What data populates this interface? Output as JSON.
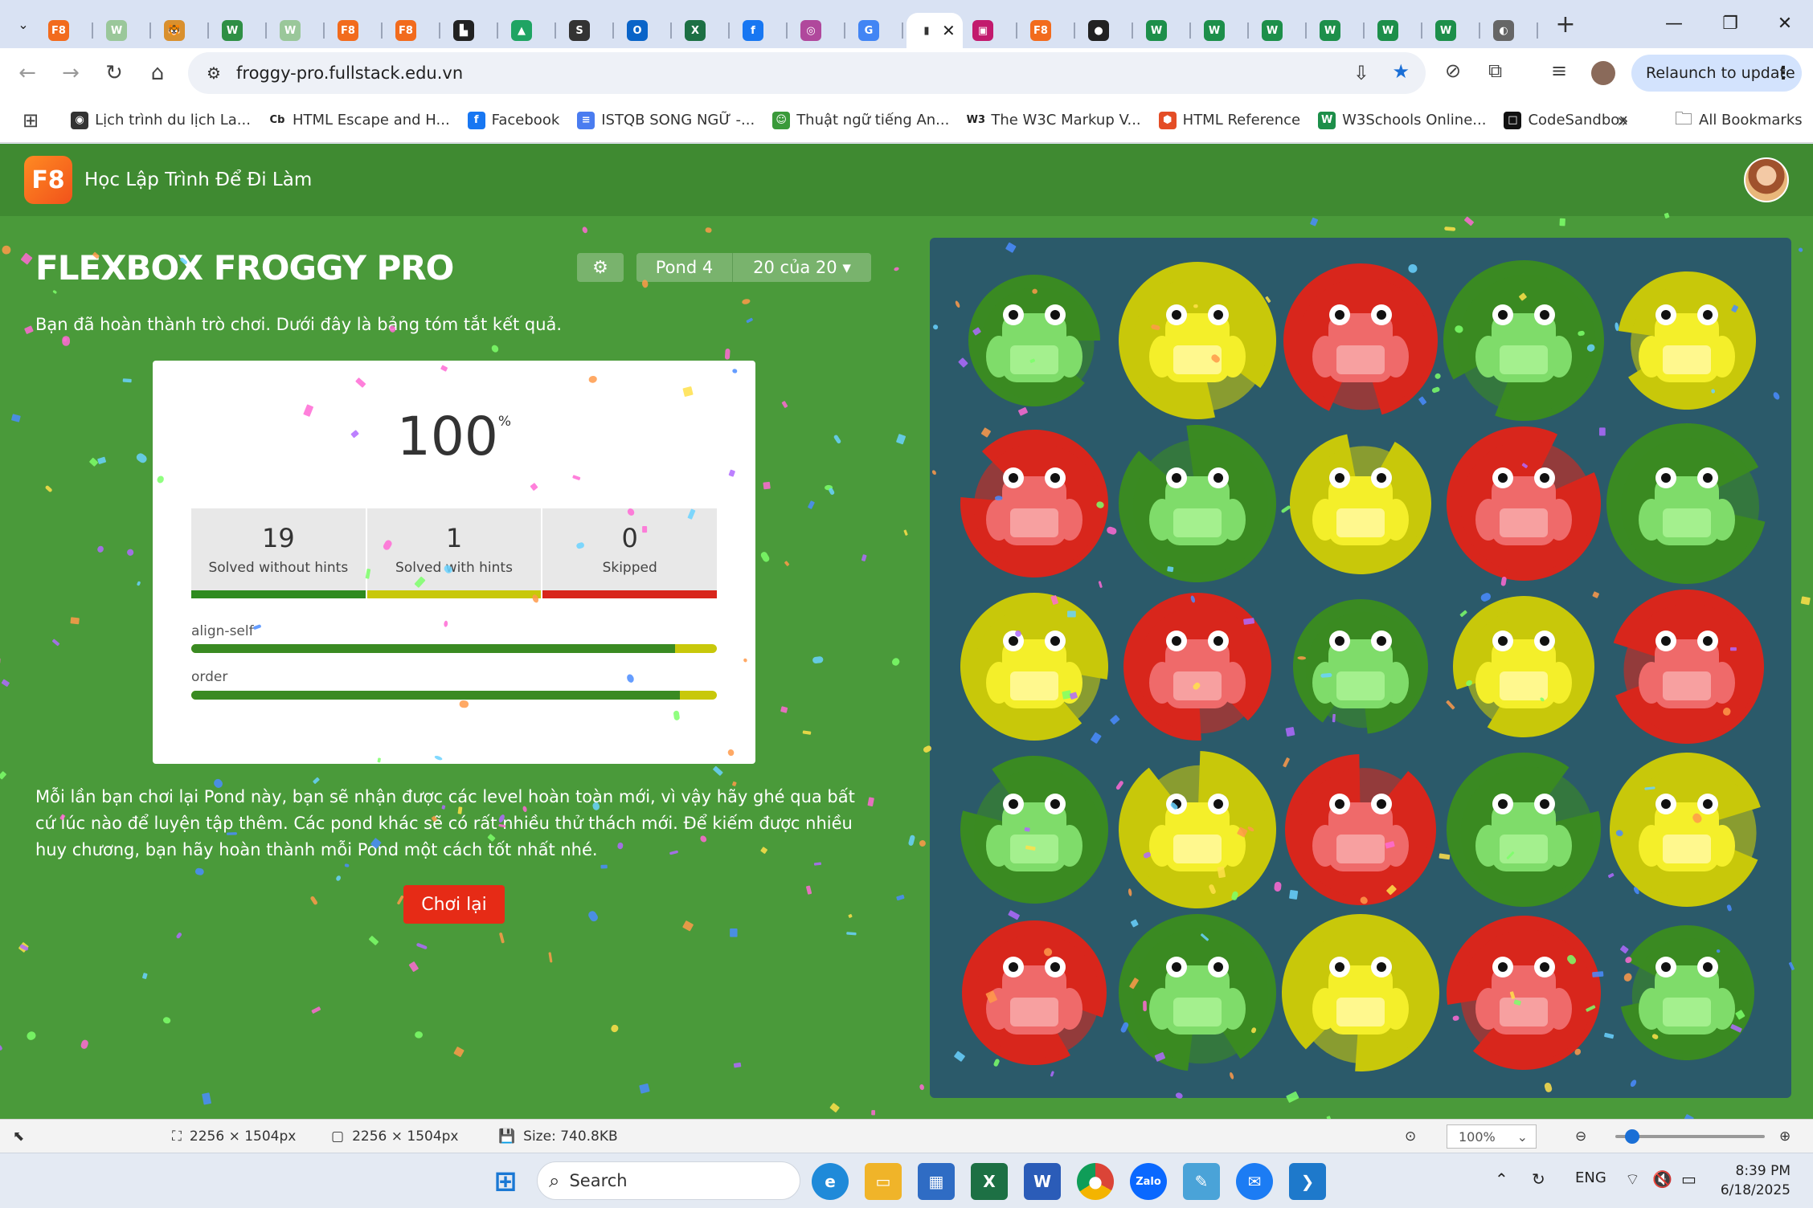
{
  "browser": {
    "tabs": [
      {
        "icon": "f8-icon",
        "bg": "#f26b1d",
        "glyph": "F8"
      },
      {
        "icon": "w3schools-icon",
        "bg": "#9ac79a",
        "glyph": "W"
      },
      {
        "icon": "tiger-icon",
        "bg": "#d9902e",
        "glyph": "🐯"
      },
      {
        "icon": "w3-green-icon",
        "bg": "#2f8f45",
        "glyph": "W"
      },
      {
        "icon": "w3schools-icon",
        "bg": "#9ac79a",
        "glyph": "W"
      },
      {
        "icon": "f8-icon",
        "bg": "#f26b1d",
        "glyph": "F8"
      },
      {
        "icon": "f8-icon",
        "bg": "#f26b1d",
        "glyph": "F8"
      },
      {
        "icon": "notion-icon",
        "bg": "#222",
        "glyph": "▙"
      },
      {
        "icon": "google-drive-icon",
        "bg": "#1fa463",
        "glyph": "▲"
      },
      {
        "icon": "studocu-icon",
        "bg": "#333",
        "glyph": "S"
      },
      {
        "icon": "outlook-icon",
        "bg": "#0a64c8",
        "glyph": "O"
      },
      {
        "icon": "excel-icon",
        "bg": "#1d7044",
        "glyph": "X"
      },
      {
        "icon": "facebook-icon",
        "bg": "#1877f2",
        "glyph": "f"
      },
      {
        "icon": "pink-app-icon",
        "bg": "#b0489c",
        "glyph": "◎"
      },
      {
        "icon": "google-icon",
        "bg": "#4285f4",
        "glyph": "G"
      },
      {
        "icon": "froggy-icon",
        "bg": "#ffffff",
        "glyph": "▮",
        "active": true
      },
      {
        "icon": "pink-square-icon",
        "bg": "#c21a6d",
        "glyph": "▣"
      },
      {
        "icon": "f8-icon",
        "bg": "#f26b1d",
        "glyph": "F8"
      },
      {
        "icon": "github-icon",
        "bg": "#222",
        "glyph": "●"
      },
      {
        "icon": "w3schools-icon",
        "bg": "#1d8f4a",
        "glyph": "W"
      },
      {
        "icon": "w3schools-icon",
        "bg": "#1d8f4a",
        "glyph": "W"
      },
      {
        "icon": "w3schools-icon",
        "bg": "#1d8f4a",
        "glyph": "W"
      },
      {
        "icon": "w3schools-icon",
        "bg": "#1d8f4a",
        "glyph": "W"
      },
      {
        "icon": "w3schools-icon",
        "bg": "#1d8f4a",
        "glyph": "W"
      },
      {
        "icon": "w3schools-icon",
        "bg": "#1d8f4a",
        "glyph": "W"
      },
      {
        "icon": "globe-icon",
        "bg": "#666",
        "glyph": "◐"
      }
    ],
    "url": "froggy-pro.fullstack.edu.vn",
    "relaunch": "Relaunch to update",
    "bookmarks": [
      {
        "label": "Lịch trình du lịch La...",
        "icon": "travel-icon",
        "bg": "#333",
        "glyph": "◉"
      },
      {
        "label": "HTML Escape and H...",
        "icon": "cb-icon",
        "bg": "#fff",
        "glyph": "Cb"
      },
      {
        "label": "Facebook",
        "icon": "facebook-icon",
        "bg": "#1877f2",
        "glyph": "f"
      },
      {
        "label": "ISTQB SONG NGỮ -...",
        "icon": "docs-icon",
        "bg": "#4a7cf0",
        "glyph": "≡"
      },
      {
        "label": "Thuật ngữ tiếng An...",
        "icon": "frog-icon",
        "bg": "#3a9a3a",
        "glyph": "☺"
      },
      {
        "label": "The W3C Markup V...",
        "icon": "w3c-icon",
        "bg": "#fff",
        "glyph": "W3"
      },
      {
        "label": "HTML Reference",
        "icon": "html-ref-icon",
        "bg": "#e44d26",
        "glyph": "⬢"
      },
      {
        "label": "W3Schools Online...",
        "icon": "w3schools-icon",
        "bg": "#1d8f4a",
        "glyph": "W"
      },
      {
        "label": "CodeSandbox",
        "icon": "codesandbox-icon",
        "bg": "#111",
        "glyph": "□"
      }
    ],
    "all_bookmarks": "All Bookmarks"
  },
  "site": {
    "logo": "F8",
    "title": "Học Lập Trình Để Đi Làm"
  },
  "game": {
    "title": "FLEXBOX FROGGY PRO",
    "pond": "Pond 4",
    "level": "20 của 20 ▾",
    "intro": "Bạn đã hoàn thành trò chơi. Dưới đây là bảng tóm tắt kết quả.",
    "score": "100",
    "score_unit": "%",
    "stats": [
      {
        "value": "19",
        "label": "Solved without hints",
        "color": "#2e8b1f"
      },
      {
        "value": "1",
        "label": "Solved with hints",
        "color": "#c8c80a"
      },
      {
        "value": "0",
        "label": "Skipped",
        "color": "#d8261c"
      }
    ],
    "progress": [
      {
        "label": "align-self",
        "fraction": 0.92
      },
      {
        "label": "order",
        "fraction": 0.93
      }
    ],
    "outro": "Mỗi lần bạn chơi lại Pond này, bạn sẽ nhận được các level hoàn toàn mới, vì vậy hãy ghé qua bất cứ lúc nào để luyện tập thêm. Các pond khác sẽ có rất nhiều thử thách mới. Để kiếm được nhiều huy chương, bạn hãy hoàn thành mỗi Pond một cách tốt nhất nhé.",
    "replay": "Chơi lại",
    "frog_grid": [
      [
        "green",
        "yellow",
        "red",
        "green",
        "yellow"
      ],
      [
        "red",
        "green",
        "yellow",
        "red",
        "green"
      ],
      [
        "yellow",
        "red",
        "green",
        "yellow",
        "red"
      ],
      [
        "green",
        "yellow",
        "red",
        "green",
        "yellow"
      ],
      [
        "red",
        "green",
        "yellow",
        "red",
        "green"
      ]
    ],
    "colors": {
      "green": {
        "pad": "#3a8a22",
        "frog": "#7fdc6a",
        "belly": "#a4f08e"
      },
      "yellow": {
        "pad": "#c8c80a",
        "frog": "#f4ef2a",
        "belly": "#fff88e"
      },
      "red": {
        "pad": "#d8261c",
        "frog": "#ef6a6a",
        "belly": "#f7a0a0"
      }
    }
  },
  "status": {
    "dims1": "2256 × 1504px",
    "dims2": "2256 × 1504px",
    "size": "Size: 740.8KB",
    "zoom": "100%"
  },
  "taskbar": {
    "search": "Search",
    "lang": "ENG",
    "time": "8:39 PM",
    "date": "6/18/2025"
  }
}
